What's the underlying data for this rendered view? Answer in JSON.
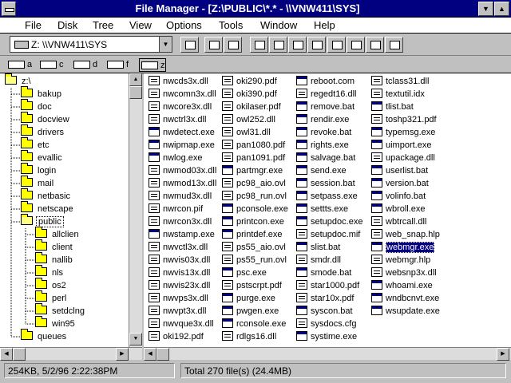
{
  "window": {
    "title": "File Manager - [Z:\\PUBLIC\\*.* - \\\\VNW411\\SYS]"
  },
  "menu": [
    "File",
    "Disk",
    "Tree",
    "View",
    "Options",
    "Tools",
    "Window",
    "Help"
  ],
  "toolbar": {
    "drive_combo_value": "Z: \\\\VNW411\\SYS"
  },
  "drives": [
    {
      "letter": "a",
      "selected": false
    },
    {
      "letter": "c",
      "selected": false
    },
    {
      "letter": "d",
      "selected": false
    },
    {
      "letter": "f",
      "selected": false
    },
    {
      "letter": "z",
      "selected": true
    }
  ],
  "tree": {
    "root": "z:\\",
    "items": [
      {
        "label": "bakup",
        "level": 1
      },
      {
        "label": "doc",
        "level": 1
      },
      {
        "label": "docview",
        "level": 1
      },
      {
        "label": "drivers",
        "level": 1
      },
      {
        "label": "etc",
        "level": 1
      },
      {
        "label": "evallic",
        "level": 1
      },
      {
        "label": "login",
        "level": 1
      },
      {
        "label": "mail",
        "level": 1
      },
      {
        "label": "netbasic",
        "level": 1
      },
      {
        "label": "netscape",
        "level": 1
      },
      {
        "label": "public",
        "level": 1,
        "selected": true,
        "open": true
      },
      {
        "label": "allclien",
        "level": 2
      },
      {
        "label": "client",
        "level": 2
      },
      {
        "label": "nallib",
        "level": 2
      },
      {
        "label": "nls",
        "level": 2
      },
      {
        "label": "os2",
        "level": 2
      },
      {
        "label": "perl",
        "level": 2
      },
      {
        "label": "setdclng",
        "level": 2
      },
      {
        "label": "win95",
        "level": 2
      },
      {
        "label": "queues",
        "level": 1
      }
    ]
  },
  "files": {
    "columns": [
      [
        {
          "name": "nwcds3x.dll",
          "icon": "doc"
        },
        {
          "name": "nwcomn3x.dll",
          "icon": "doc"
        },
        {
          "name": "nwcore3x.dll",
          "icon": "doc"
        },
        {
          "name": "nwctrl3x.dll",
          "icon": "doc"
        },
        {
          "name": "nwdetect.exe",
          "icon": "exe"
        },
        {
          "name": "nwipmap.exe",
          "icon": "exe"
        },
        {
          "name": "nwlog.exe",
          "icon": "exe"
        },
        {
          "name": "nwmod03x.dll",
          "icon": "doc"
        },
        {
          "name": "nwmod13x.dll",
          "icon": "doc"
        },
        {
          "name": "nwmud3x.dll",
          "icon": "doc"
        },
        {
          "name": "nwrcon.pif",
          "icon": "doc"
        },
        {
          "name": "nwrcon3x.dll",
          "icon": "doc"
        },
        {
          "name": "nwstamp.exe",
          "icon": "exe"
        },
        {
          "name": "nwvctl3x.dll",
          "icon": "doc"
        },
        {
          "name": "nwvis03x.dll",
          "icon": "doc"
        },
        {
          "name": "nwvis13x.dll",
          "icon": "doc"
        },
        {
          "name": "nwvis23x.dll",
          "icon": "doc"
        },
        {
          "name": "nwvps3x.dll",
          "icon": "doc"
        },
        {
          "name": "nwvpt3x.dll",
          "icon": "doc"
        },
        {
          "name": "nwvque3x.dll",
          "icon": "doc"
        },
        {
          "name": "oki192.pdf",
          "icon": "doc"
        }
      ],
      [
        {
          "name": "oki290.pdf",
          "icon": "doc"
        },
        {
          "name": "oki390.pdf",
          "icon": "doc"
        },
        {
          "name": "okilaser.pdf",
          "icon": "doc"
        },
        {
          "name": "owl252.dll",
          "icon": "doc"
        },
        {
          "name": "owl31.dll",
          "icon": "doc"
        },
        {
          "name": "pan1080.pdf",
          "icon": "doc"
        },
        {
          "name": "pan1091.pdf",
          "icon": "doc"
        },
        {
          "name": "partmgr.exe",
          "icon": "exe"
        },
        {
          "name": "pc98_aio.ovl",
          "icon": "doc"
        },
        {
          "name": "pc98_run.ovl",
          "icon": "doc"
        },
        {
          "name": "pconsole.exe",
          "icon": "exe"
        },
        {
          "name": "printcon.exe",
          "icon": "exe"
        },
        {
          "name": "printdef.exe",
          "icon": "exe"
        },
        {
          "name": "ps55_aio.ovl",
          "icon": "doc"
        },
        {
          "name": "ps55_run.ovl",
          "icon": "doc"
        },
        {
          "name": "psc.exe",
          "icon": "exe"
        },
        {
          "name": "pstscrpt.pdf",
          "icon": "doc"
        },
        {
          "name": "purge.exe",
          "icon": "exe"
        },
        {
          "name": "pwgen.exe",
          "icon": "exe"
        },
        {
          "name": "rconsole.exe",
          "icon": "exe"
        },
        {
          "name": "rdlgs16.dll",
          "icon": "doc"
        }
      ],
      [
        {
          "name": "reboot.com",
          "icon": "exe"
        },
        {
          "name": "regedt16.dll",
          "icon": "doc"
        },
        {
          "name": "remove.bat",
          "icon": "exe"
        },
        {
          "name": "rendir.exe",
          "icon": "exe"
        },
        {
          "name": "revoke.bat",
          "icon": "exe"
        },
        {
          "name": "rights.exe",
          "icon": "exe"
        },
        {
          "name": "salvage.bat",
          "icon": "exe"
        },
        {
          "name": "send.exe",
          "icon": "exe"
        },
        {
          "name": "session.bat",
          "icon": "exe"
        },
        {
          "name": "setpass.exe",
          "icon": "exe"
        },
        {
          "name": "settts.exe",
          "icon": "exe"
        },
        {
          "name": "setupdoc.exe",
          "icon": "exe"
        },
        {
          "name": "setupdoc.mif",
          "icon": "doc"
        },
        {
          "name": "slist.bat",
          "icon": "exe"
        },
        {
          "name": "smdr.dll",
          "icon": "doc"
        },
        {
          "name": "smode.bat",
          "icon": "exe"
        },
        {
          "name": "star1000.pdf",
          "icon": "doc"
        },
        {
          "name": "star10x.pdf",
          "icon": "doc"
        },
        {
          "name": "syscon.bat",
          "icon": "exe"
        },
        {
          "name": "sysdocs.cfg",
          "icon": "doc"
        },
        {
          "name": "systime.exe",
          "icon": "exe"
        }
      ],
      [
        {
          "name": "tclass31.dll",
          "icon": "doc"
        },
        {
          "name": "textutil.idx",
          "icon": "doc"
        },
        {
          "name": "tlist.bat",
          "icon": "exe"
        },
        {
          "name": "toshp321.pdf",
          "icon": "doc"
        },
        {
          "name": "typemsg.exe",
          "icon": "exe"
        },
        {
          "name": "uimport.exe",
          "icon": "exe"
        },
        {
          "name": "upackage.dll",
          "icon": "doc"
        },
        {
          "name": "userlist.bat",
          "icon": "exe"
        },
        {
          "name": "version.bat",
          "icon": "exe"
        },
        {
          "name": "volinfo.bat",
          "icon": "exe"
        },
        {
          "name": "wbroll.exe",
          "icon": "exe"
        },
        {
          "name": "wbtrcall.dll",
          "icon": "doc"
        },
        {
          "name": "web_snap.hlp",
          "icon": "doc"
        },
        {
          "name": "webmgr.exe",
          "icon": "exe",
          "selected": true
        },
        {
          "name": "webmgr.hlp",
          "icon": "doc"
        },
        {
          "name": "websnp3x.dll",
          "icon": "doc"
        },
        {
          "name": "whoami.exe",
          "icon": "exe"
        },
        {
          "name": "wndbcnvt.exe",
          "icon": "exe"
        },
        {
          "name": "wsupdate.exe",
          "icon": "exe"
        }
      ]
    ]
  },
  "status": {
    "left": "254KB, 5/2/96 2:22:38PM",
    "right": "Total 270 file(s) (24.4MB)"
  }
}
